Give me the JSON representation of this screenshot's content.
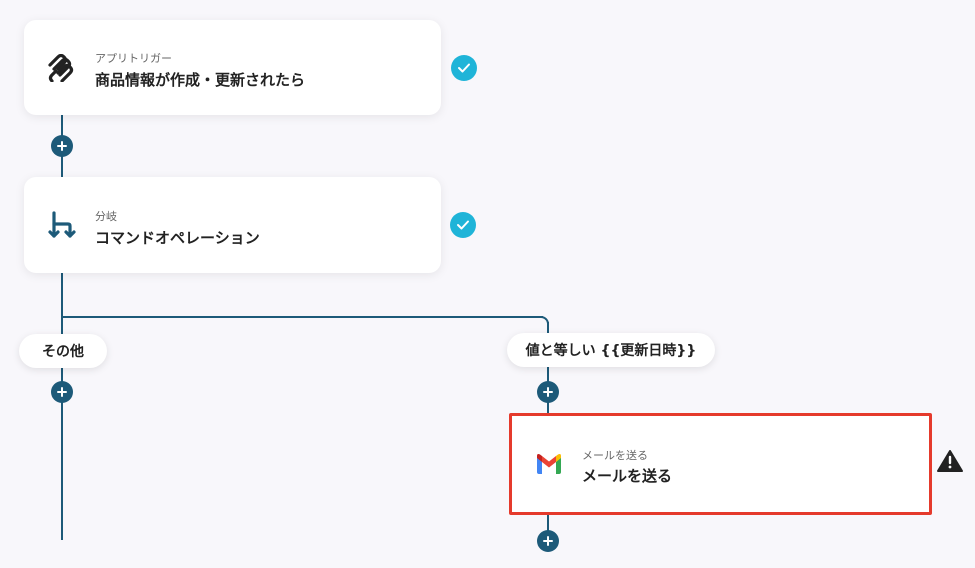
{
  "steps": {
    "trigger": {
      "subtitle": "アプリトリガー",
      "title": "商品情報が作成・更新されたら",
      "icon": "squarespace-logo-icon",
      "status": "complete"
    },
    "branch": {
      "subtitle": "分岐",
      "title": "コマンドオペレーション",
      "icon": "branch-icon",
      "status": "complete"
    },
    "mail": {
      "subtitle": "メールを送る",
      "title": "メールを送る",
      "icon": "gmail-icon",
      "status": "warning"
    }
  },
  "branches": {
    "other_label": "その他",
    "condition_label": "値と等しい {{更新日時}}"
  },
  "colors": {
    "connector": "#1d5a79",
    "check": "#1fb4d8",
    "selected_border": "#e53a2c",
    "background": "#f8f7fb"
  }
}
